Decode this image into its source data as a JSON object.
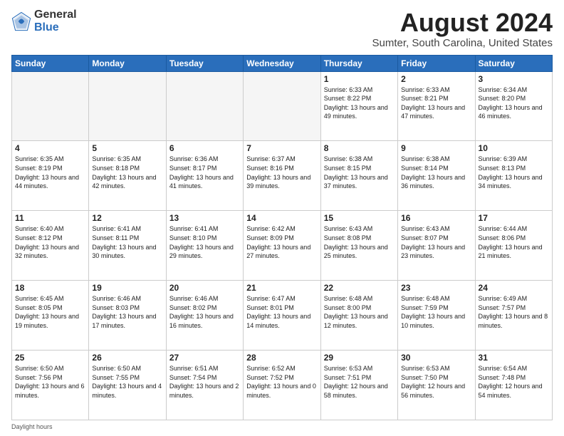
{
  "logo": {
    "general": "General",
    "blue": "Blue"
  },
  "title": "August 2024",
  "location": "Sumter, South Carolina, United States",
  "days_of_week": [
    "Sunday",
    "Monday",
    "Tuesday",
    "Wednesday",
    "Thursday",
    "Friday",
    "Saturday"
  ],
  "footer": "Daylight hours",
  "weeks": [
    [
      {
        "day": "",
        "info": ""
      },
      {
        "day": "",
        "info": ""
      },
      {
        "day": "",
        "info": ""
      },
      {
        "day": "",
        "info": ""
      },
      {
        "day": "1",
        "info": "Sunrise: 6:33 AM\nSunset: 8:22 PM\nDaylight: 13 hours and 49 minutes."
      },
      {
        "day": "2",
        "info": "Sunrise: 6:33 AM\nSunset: 8:21 PM\nDaylight: 13 hours and 47 minutes."
      },
      {
        "day": "3",
        "info": "Sunrise: 6:34 AM\nSunset: 8:20 PM\nDaylight: 13 hours and 46 minutes."
      }
    ],
    [
      {
        "day": "4",
        "info": "Sunrise: 6:35 AM\nSunset: 8:19 PM\nDaylight: 13 hours and 44 minutes."
      },
      {
        "day": "5",
        "info": "Sunrise: 6:35 AM\nSunset: 8:18 PM\nDaylight: 13 hours and 42 minutes."
      },
      {
        "day": "6",
        "info": "Sunrise: 6:36 AM\nSunset: 8:17 PM\nDaylight: 13 hours and 41 minutes."
      },
      {
        "day": "7",
        "info": "Sunrise: 6:37 AM\nSunset: 8:16 PM\nDaylight: 13 hours and 39 minutes."
      },
      {
        "day": "8",
        "info": "Sunrise: 6:38 AM\nSunset: 8:15 PM\nDaylight: 13 hours and 37 minutes."
      },
      {
        "day": "9",
        "info": "Sunrise: 6:38 AM\nSunset: 8:14 PM\nDaylight: 13 hours and 36 minutes."
      },
      {
        "day": "10",
        "info": "Sunrise: 6:39 AM\nSunset: 8:13 PM\nDaylight: 13 hours and 34 minutes."
      }
    ],
    [
      {
        "day": "11",
        "info": "Sunrise: 6:40 AM\nSunset: 8:12 PM\nDaylight: 13 hours and 32 minutes."
      },
      {
        "day": "12",
        "info": "Sunrise: 6:41 AM\nSunset: 8:11 PM\nDaylight: 13 hours and 30 minutes."
      },
      {
        "day": "13",
        "info": "Sunrise: 6:41 AM\nSunset: 8:10 PM\nDaylight: 13 hours and 29 minutes."
      },
      {
        "day": "14",
        "info": "Sunrise: 6:42 AM\nSunset: 8:09 PM\nDaylight: 13 hours and 27 minutes."
      },
      {
        "day": "15",
        "info": "Sunrise: 6:43 AM\nSunset: 8:08 PM\nDaylight: 13 hours and 25 minutes."
      },
      {
        "day": "16",
        "info": "Sunrise: 6:43 AM\nSunset: 8:07 PM\nDaylight: 13 hours and 23 minutes."
      },
      {
        "day": "17",
        "info": "Sunrise: 6:44 AM\nSunset: 8:06 PM\nDaylight: 13 hours and 21 minutes."
      }
    ],
    [
      {
        "day": "18",
        "info": "Sunrise: 6:45 AM\nSunset: 8:05 PM\nDaylight: 13 hours and 19 minutes."
      },
      {
        "day": "19",
        "info": "Sunrise: 6:46 AM\nSunset: 8:03 PM\nDaylight: 13 hours and 17 minutes."
      },
      {
        "day": "20",
        "info": "Sunrise: 6:46 AM\nSunset: 8:02 PM\nDaylight: 13 hours and 16 minutes."
      },
      {
        "day": "21",
        "info": "Sunrise: 6:47 AM\nSunset: 8:01 PM\nDaylight: 13 hours and 14 minutes."
      },
      {
        "day": "22",
        "info": "Sunrise: 6:48 AM\nSunset: 8:00 PM\nDaylight: 13 hours and 12 minutes."
      },
      {
        "day": "23",
        "info": "Sunrise: 6:48 AM\nSunset: 7:59 PM\nDaylight: 13 hours and 10 minutes."
      },
      {
        "day": "24",
        "info": "Sunrise: 6:49 AM\nSunset: 7:57 PM\nDaylight: 13 hours and 8 minutes."
      }
    ],
    [
      {
        "day": "25",
        "info": "Sunrise: 6:50 AM\nSunset: 7:56 PM\nDaylight: 13 hours and 6 minutes."
      },
      {
        "day": "26",
        "info": "Sunrise: 6:50 AM\nSunset: 7:55 PM\nDaylight: 13 hours and 4 minutes."
      },
      {
        "day": "27",
        "info": "Sunrise: 6:51 AM\nSunset: 7:54 PM\nDaylight: 13 hours and 2 minutes."
      },
      {
        "day": "28",
        "info": "Sunrise: 6:52 AM\nSunset: 7:52 PM\nDaylight: 13 hours and 0 minutes."
      },
      {
        "day": "29",
        "info": "Sunrise: 6:53 AM\nSunset: 7:51 PM\nDaylight: 12 hours and 58 minutes."
      },
      {
        "day": "30",
        "info": "Sunrise: 6:53 AM\nSunset: 7:50 PM\nDaylight: 12 hours and 56 minutes."
      },
      {
        "day": "31",
        "info": "Sunrise: 6:54 AM\nSunset: 7:48 PM\nDaylight: 12 hours and 54 minutes."
      }
    ]
  ]
}
